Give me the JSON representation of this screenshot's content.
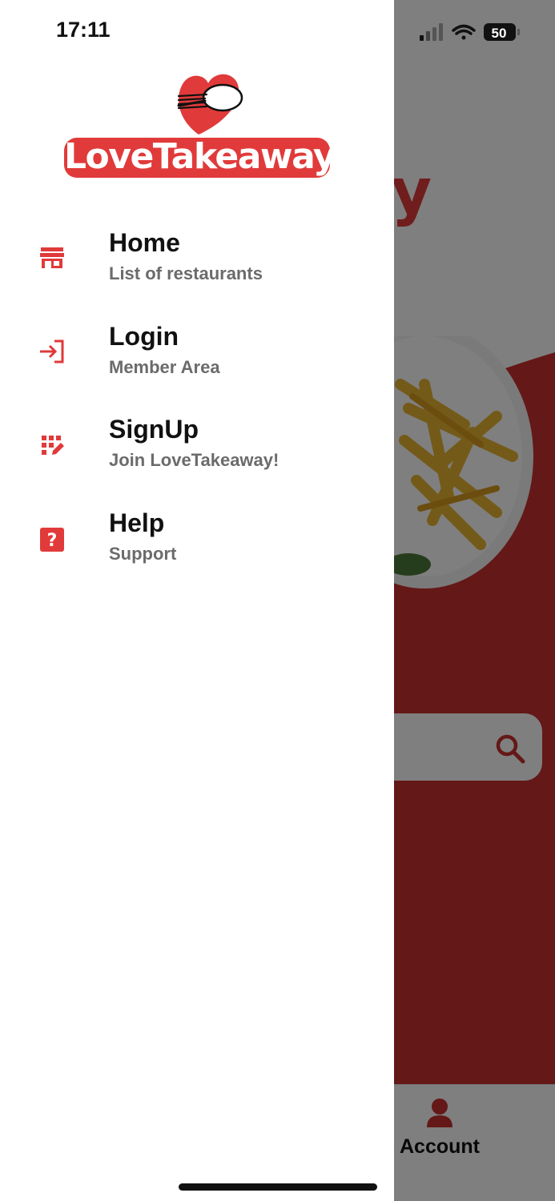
{
  "status_bar": {
    "time": "17:11",
    "battery": "50"
  },
  "brand": {
    "name": "LoveTakeaway",
    "accent_color": "#e13a3a"
  },
  "menu": {
    "items": [
      {
        "title": "Home",
        "subtitle": "List of restaurants",
        "icon": "store-icon"
      },
      {
        "title": "Login",
        "subtitle": "Member Area",
        "icon": "login-arrow-icon"
      },
      {
        "title": "SignUp",
        "subtitle": "Join LoveTakeaway!",
        "icon": "signup-grid-pen-icon"
      },
      {
        "title": "Help",
        "subtitle": "Support",
        "icon": "question-mark-icon"
      }
    ]
  },
  "background": {
    "logo_tail": "ay",
    "tabbar": {
      "account_label": "Account"
    }
  }
}
